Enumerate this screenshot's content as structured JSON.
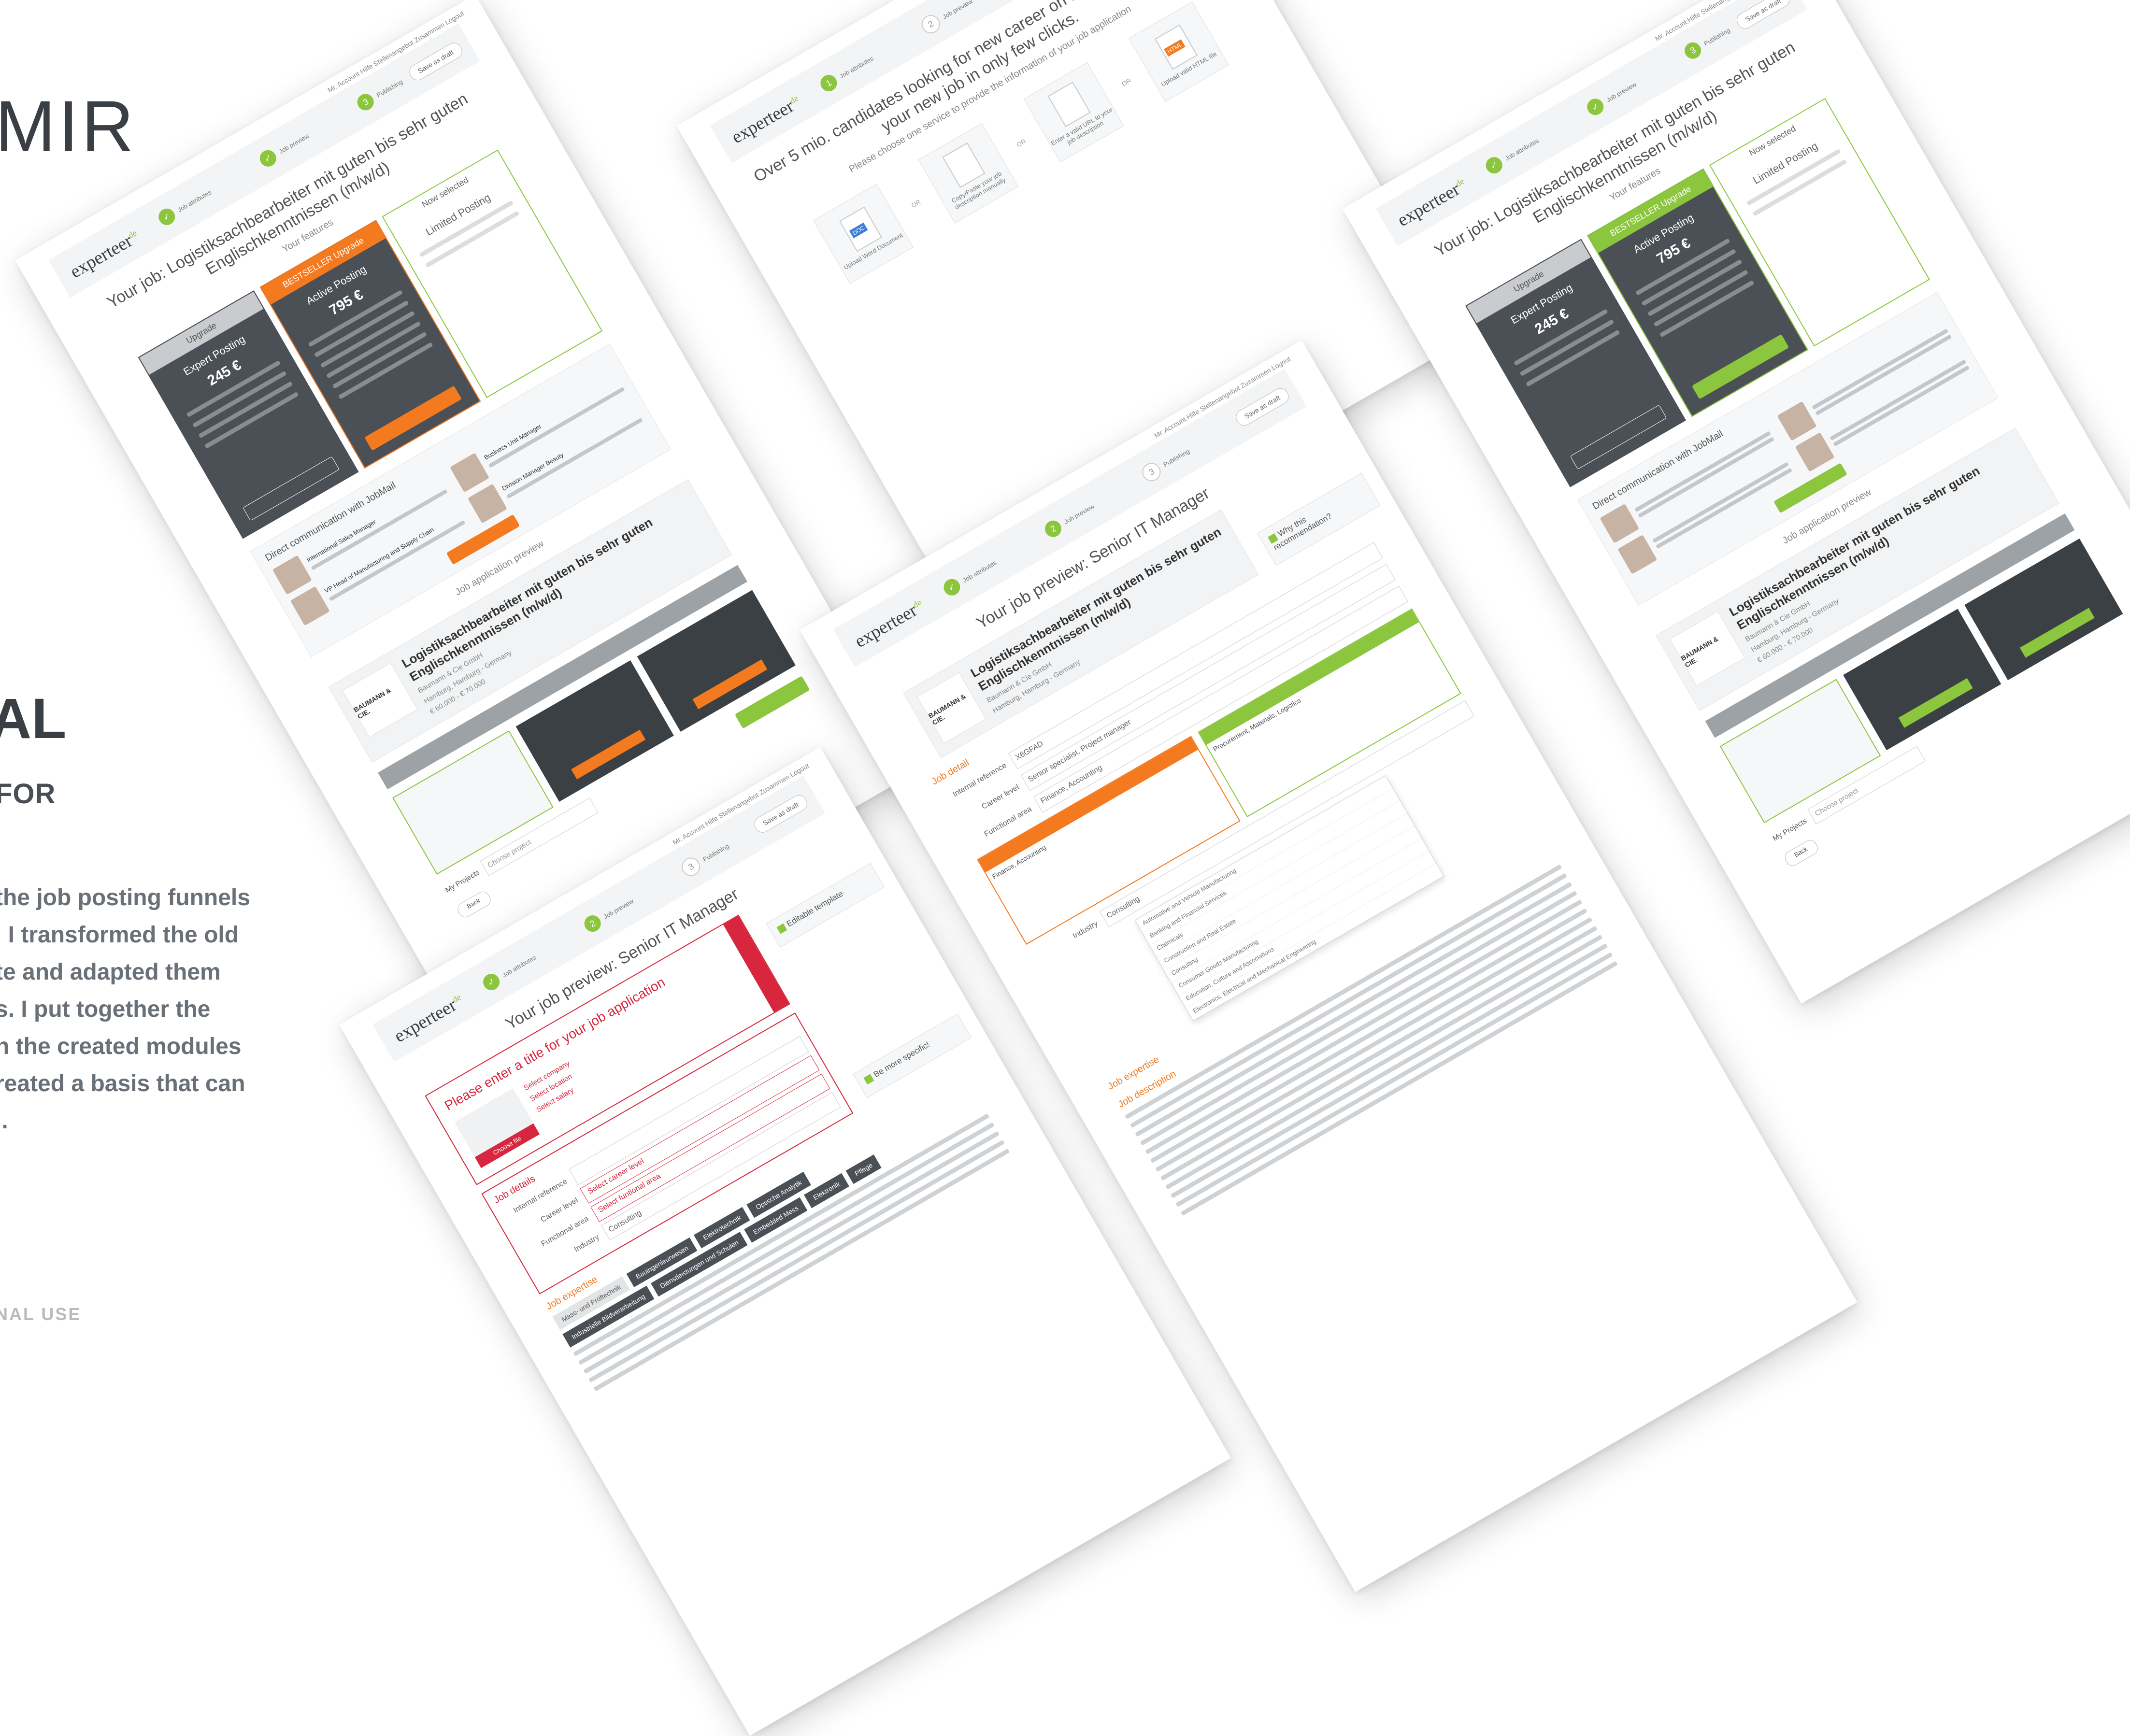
{
  "portfolio": {
    "brand": "MIR",
    "heading": "AL",
    "subheading": "FOR",
    "description_lines": [
      "the job posting funnels",
      ". I transformed the old",
      "te and adapted them",
      "s. I put together the",
      "n the created modules",
      "reated a basis that can",
      "l."
    ],
    "footnote": "NAL USE"
  },
  "app": {
    "logo": "experteer",
    "logo_suffix": "de",
    "top_links": "Mr. Account   Hilfe   Stellenangebot Zusammen   Logout",
    "save_draft": "Save as draft",
    "steps": [
      "Job attributes",
      "Job preview",
      "Publishing"
    ],
    "back": "Back"
  },
  "shot_a": {
    "title": "Your job: Logistiksachbearbeiter mit guten bis sehr guten Englischkenntnissen (m/w/d)",
    "features_label": "Your features",
    "cards": [
      {
        "badge": "Upgrade",
        "name": "Expert Posting",
        "price": "245 €"
      },
      {
        "badge": "BESTSELLER Upgrade",
        "name": "Active Posting",
        "price": "795 €"
      },
      {
        "badge": "Now selected",
        "name": "Limited Posting",
        "price": ""
      }
    ],
    "jobmail_title": "Direct communication with JobMail",
    "jobmail_people": [
      "International Sales Manager",
      "Business Unit Manager",
      "VP Head of Manufacturing and Supply Chain",
      "Division Manager Beauty"
    ],
    "preview_label": "Job application preview",
    "job_title": "Logistiksachbearbeiter mit guten bis sehr guten Englischkenntnissen (m/w/d)",
    "company": "Baumann & Cie GmbH",
    "company_logo": "BAUMANN & CIE.",
    "location": "Hamburg, Hamburg - Germany",
    "salary": "€ 60.000 - € 70.000",
    "projects_label": "My Projects",
    "projects_placeholder": "Choose project"
  },
  "shot_b": {
    "title": "Over 5 mio. candidates looking for new career on Experteer. Publish your new job in only few clicks.",
    "instruction": "Please choose one service to provide the information of your job application",
    "options": [
      "Upload Word Document",
      "Copy/Paste your job description manually",
      "Enter a valid URL to your job description",
      "Upload valid HTML file"
    ],
    "or": "OR"
  },
  "shot_c": {
    "title": "Your job preview: Senior IT Manager",
    "job_title": "Logistiksachbearbeiter mit guten bis sehr guten Englischkenntnissen (m/w/d)",
    "recommendation": "Why this recommendation?",
    "job_detail": "Job detail",
    "internal_reference": "Internal reference",
    "internal_reference_value": "X6GFAD",
    "career_level": "Career level",
    "career_level_value": "Senior specialist, Project manager",
    "functional_area": "Functional area",
    "functional_area_value": "Finance, Accounting",
    "rec_cards": [
      "Finance, Accounting",
      "Procurement, Materials, Logistics"
    ],
    "industry": "Industry",
    "industry_value": "Consulting",
    "dropdown": [
      "Automotive and Vehicle Manufacturing",
      "Banking and Financial Services",
      "Chemicals",
      "Construction and Real Estate",
      "Consulting",
      "Consumer Goods Manufacturing",
      "Education, Culture and Associations",
      "Electronics, Electrical and Mechanical Engineering"
    ],
    "job_expertise": "Job expertise",
    "job_description": "Job description"
  },
  "shot_d": {
    "title": "Your job: Logistiksachbearbeiter mit guten bis sehr guten Englischkenntnissen (m/w/d)",
    "features_label": "Your features",
    "cards": [
      {
        "badge": "Upgrade",
        "name": "Expert Posting",
        "price": "245 €"
      },
      {
        "badge": "BESTSELLER Upgrade",
        "name": "Active Posting",
        "price": "795 €"
      },
      {
        "badge": "Now selected",
        "name": "Limited Posting",
        "price": ""
      }
    ],
    "jobmail_title": "Direct communication with JobMail",
    "preview_label": "Job application preview",
    "job_title": "Logistiksachbearbeiter mit guten bis sehr guten Englischkenntnissen (m/w/d)",
    "company": "Baumann & Cie GmbH",
    "company_logo": "BAUMANN & CIE.",
    "location": "Hamburg, Hamburg - Germany",
    "salary": "€ 60.000 - € 70.000",
    "projects_label": "My Projects",
    "projects_placeholder": "Choose project"
  },
  "shot_e": {
    "title": "Your job preview: Senior IT Manager",
    "editable": "Editable template",
    "error_title": "Please enter a title for your job application",
    "choose_file": "Choose file",
    "select_company": "Select company",
    "select_location": "Select location",
    "select_salary": "Select salary",
    "be_specific": "Be more specific!",
    "job_details": "Job details",
    "internal_reference": "Internal reference",
    "career_level": "Career level",
    "career_level_value": "Select career level",
    "functional_area": "Functional area",
    "functional_area_value": "Select funtional area",
    "industry": "Industry",
    "industry_value": "Consulting",
    "job_expertise": "Job expertise",
    "tags": [
      "Mass- und Prüftechnik",
      "Bauingenieurwesen",
      "Elektrotechnik",
      "Optische Analytik",
      "Industrielle Bildverarbeitung",
      "Dienstleistungen und Schulen",
      "Embedded Mess",
      "Elektronik",
      "Pflege"
    ]
  }
}
